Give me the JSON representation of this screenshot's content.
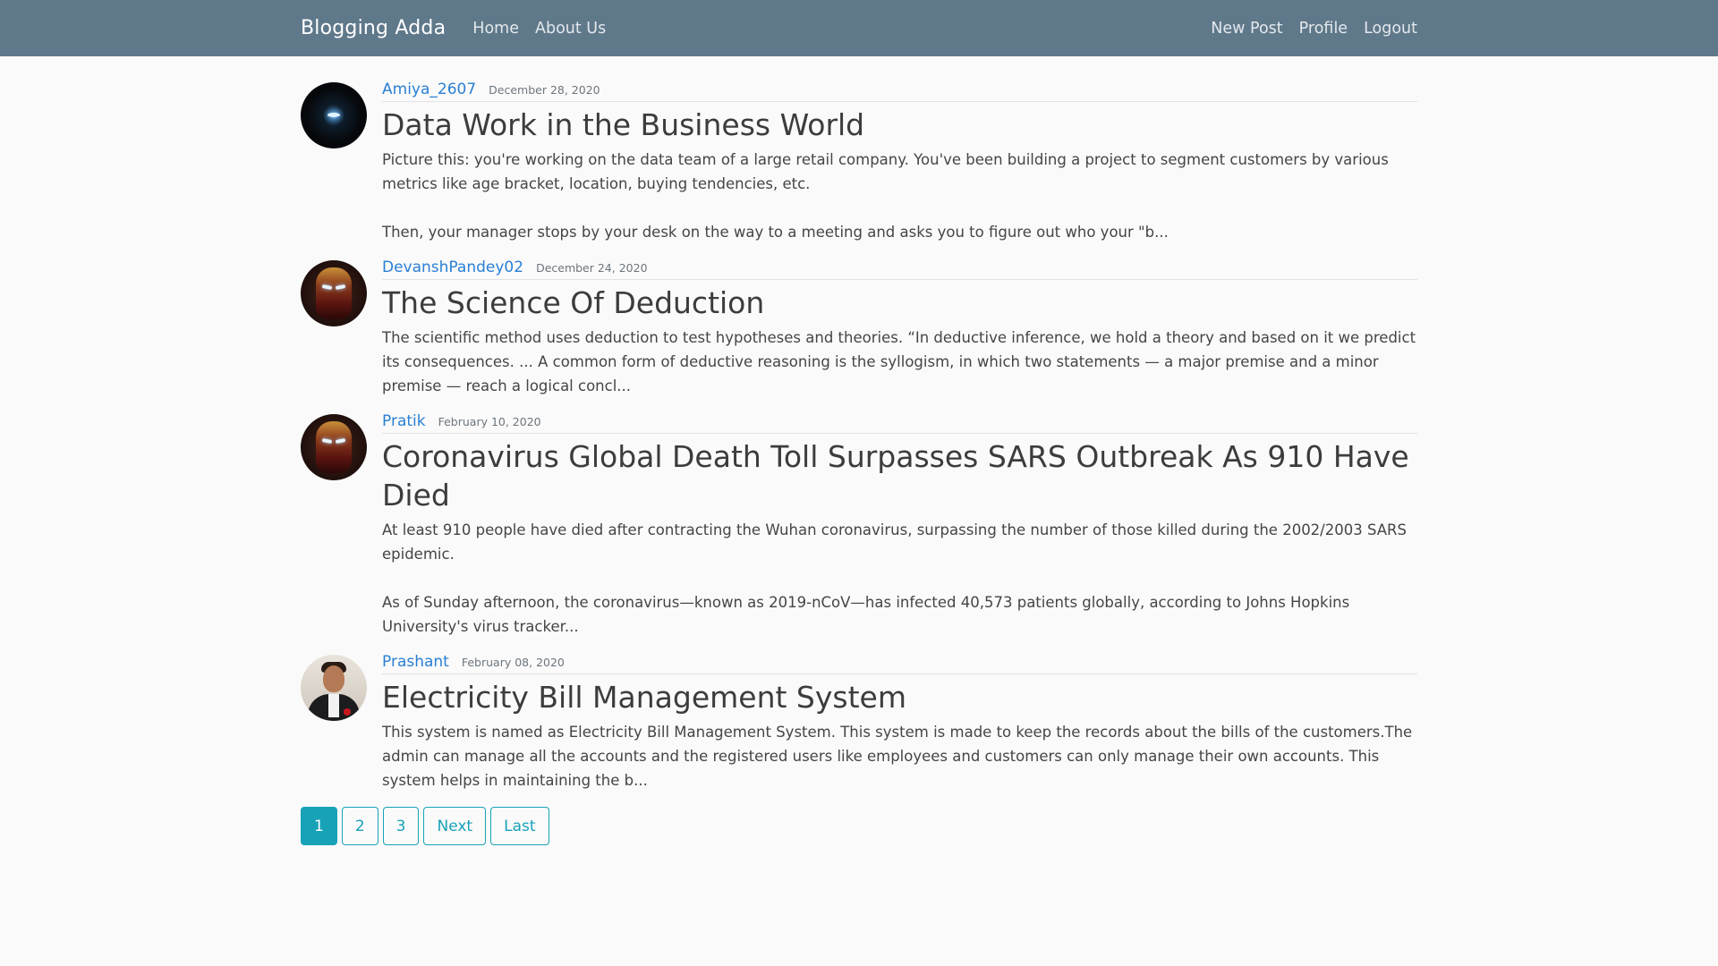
{
  "nav": {
    "brand": "Blogging Adda",
    "left_links": [
      "Home",
      "About Us"
    ],
    "right_links": [
      "New Post",
      "Profile",
      "Logout"
    ]
  },
  "posts": [
    {
      "author": "Amiya_2607",
      "date": "December 28, 2020",
      "title": "Data Work in the Business World",
      "excerpt": "Picture this: you're working on the data team of a large retail company. You've been building a project to segment customers by various metrics like age bracket, location, buying tendencies, etc.\n\nThen, your manager stops by your desk on the way to a meeting and asks you to figure out who your \"b..."
    },
    {
      "author": "DevanshPandey02",
      "date": "December 24, 2020",
      "title": "The Science Of Deduction",
      "excerpt": "The scientific method uses deduction to test hypotheses and theories. “In deductive inference, we hold a theory and based on it we predict its consequences. ... A common form of deductive reasoning is the syllogism, in which two statements — a major premise and a minor premise — reach a logical concl..."
    },
    {
      "author": "Pratik",
      "date": "February 10, 2020",
      "title": "Coronavirus Global Death Toll Surpasses SARS Outbreak As 910 Have Died",
      "excerpt": "At least 910 people have died after contracting the Wuhan coronavirus, surpassing the number of those killed during the 2002/2003 SARS epidemic.\n\nAs of Sunday afternoon, the coronavirus—known as 2019-nCoV—has infected 40,573 patients globally, according to Johns Hopkins University's virus tracker..."
    },
    {
      "author": "Prashant",
      "date": "February 08, 2020",
      "title": "Electricity Bill Management System",
      "excerpt": "This system is named as Electricity Bill Management System. This system is made to keep the records about the bills of the customers.The admin can manage all the accounts and the registered users like employees and customers can only manage their own accounts. This system helps in maintaining the b..."
    }
  ],
  "pagination": {
    "pages": [
      "1",
      "2",
      "3"
    ],
    "next": "Next",
    "last": "Last",
    "active": "1"
  },
  "colors": {
    "navbar": "#5f788a",
    "link": "#2a7fd4",
    "accent": "#17a2b8"
  }
}
